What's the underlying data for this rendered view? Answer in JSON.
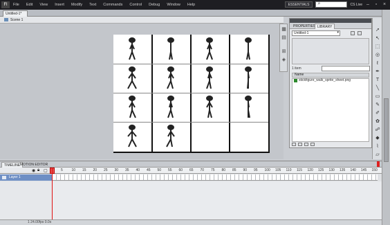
{
  "menubar": {
    "logo": "Fl",
    "items": [
      "File",
      "Edit",
      "View",
      "Insert",
      "Modify",
      "Text",
      "Commands",
      "Control",
      "Debug",
      "Window",
      "Help"
    ],
    "workspace": "ESSENTIALS",
    "search_placeholder": "",
    "cs_live": "CS Live"
  },
  "document": {
    "tab_label": "Untitled-1*",
    "scene_label": "Scene 1"
  },
  "panel": {
    "tabs": [
      "PROPERTIES",
      "LIBRARY"
    ],
    "active_tab": "LIBRARY",
    "selected_document": "Untitled-1",
    "item_count": "1 item",
    "search_value": "",
    "column_header": "Name",
    "items": [
      "stickfigure_walk_sprite_sheet.png"
    ]
  },
  "timeline": {
    "tabs": [
      "TIMELINE",
      "MOTION EDITOR"
    ],
    "active_tab": "TIMELINE",
    "layer_name": "Layer 1",
    "ruler_ticks": [
      "5",
      "10",
      "15",
      "20",
      "25",
      "30",
      "35",
      "40",
      "45",
      "50",
      "55",
      "60",
      "65",
      "70",
      "75",
      "80",
      "85",
      "90",
      "95",
      "100",
      "105",
      "110",
      "115",
      "120",
      "125",
      "130",
      "135",
      "140",
      "145",
      "150"
    ],
    "footer": "1   24.00fps   0.0s"
  },
  "colors": {
    "menubar_bg": "#1e1e22",
    "layer_selected": "#6e8fc5",
    "playhead": "#e01010"
  }
}
